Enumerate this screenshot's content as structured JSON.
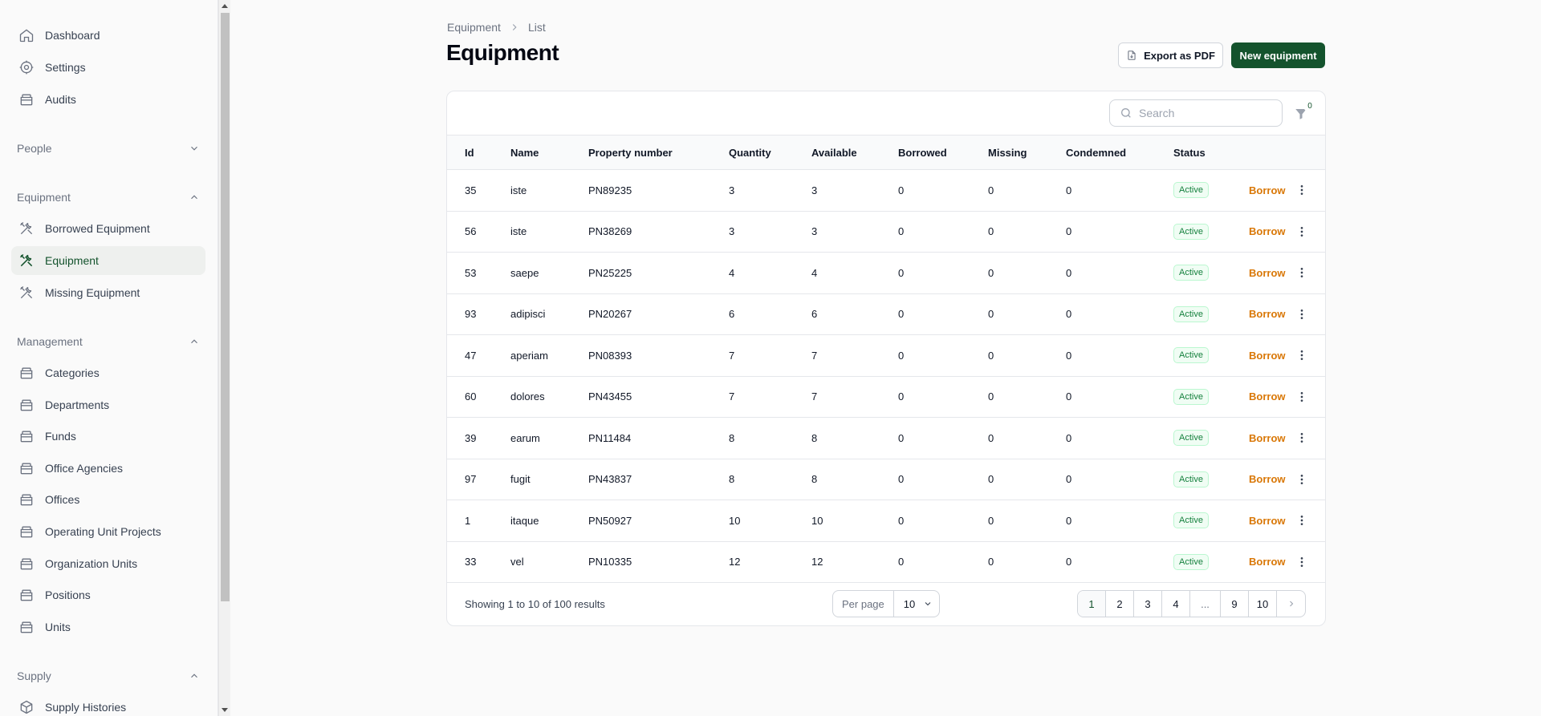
{
  "sidebar": {
    "top_items": [
      {
        "label": "Dashboard",
        "icon": "home-icon"
      },
      {
        "label": "Settings",
        "icon": "gear-icon"
      },
      {
        "label": "Audits",
        "icon": "box-icon"
      }
    ],
    "groups": {
      "people": {
        "label": "People",
        "expanded": false
      },
      "equipment": {
        "label": "Equipment",
        "expanded": true,
        "items": [
          {
            "label": "Borrowed Equipment",
            "icon": "tools-icon"
          },
          {
            "label": "Equipment",
            "icon": "tools-icon",
            "active": true
          },
          {
            "label": "Missing Equipment",
            "icon": "tools-icon"
          }
        ]
      },
      "management": {
        "label": "Management",
        "expanded": true,
        "items": [
          {
            "label": "Categories",
            "icon": "box-icon"
          },
          {
            "label": "Departments",
            "icon": "box-icon"
          },
          {
            "label": "Funds",
            "icon": "box-icon"
          },
          {
            "label": "Office Agencies",
            "icon": "box-icon"
          },
          {
            "label": "Offices",
            "icon": "box-icon"
          },
          {
            "label": "Operating Unit Projects",
            "icon": "box-icon"
          },
          {
            "label": "Organization Units",
            "icon": "box-icon"
          },
          {
            "label": "Positions",
            "icon": "box-icon"
          },
          {
            "label": "Units",
            "icon": "box-icon"
          }
        ]
      },
      "supply": {
        "label": "Supply",
        "expanded": true,
        "items": [
          {
            "label": "Supply Histories",
            "icon": "cube-icon"
          }
        ]
      }
    }
  },
  "breadcrumb": {
    "items": [
      "Equipment",
      "List"
    ]
  },
  "page": {
    "title": "Equipment"
  },
  "actions": {
    "export_label": "Export as PDF",
    "new_label": "New equipment"
  },
  "search": {
    "placeholder": "Search",
    "value": ""
  },
  "filter": {
    "count": "0"
  },
  "table": {
    "columns": [
      "Id",
      "Name",
      "Property number",
      "Quantity",
      "Available",
      "Borrowed",
      "Missing",
      "Condemned",
      "Status"
    ],
    "rows": [
      {
        "id": "35",
        "name": "iste",
        "property_number": "PN89235",
        "quantity": "3",
        "available": "3",
        "borrowed": "0",
        "missing": "0",
        "condemned": "0",
        "status": "Active",
        "action": "Borrow"
      },
      {
        "id": "56",
        "name": "iste",
        "property_number": "PN38269",
        "quantity": "3",
        "available": "3",
        "borrowed": "0",
        "missing": "0",
        "condemned": "0",
        "status": "Active",
        "action": "Borrow"
      },
      {
        "id": "53",
        "name": "saepe",
        "property_number": "PN25225",
        "quantity": "4",
        "available": "4",
        "borrowed": "0",
        "missing": "0",
        "condemned": "0",
        "status": "Active",
        "action": "Borrow"
      },
      {
        "id": "93",
        "name": "adipisci",
        "property_number": "PN20267",
        "quantity": "6",
        "available": "6",
        "borrowed": "0",
        "missing": "0",
        "condemned": "0",
        "status": "Active",
        "action": "Borrow"
      },
      {
        "id": "47",
        "name": "aperiam",
        "property_number": "PN08393",
        "quantity": "7",
        "available": "7",
        "borrowed": "0",
        "missing": "0",
        "condemned": "0",
        "status": "Active",
        "action": "Borrow"
      },
      {
        "id": "60",
        "name": "dolores",
        "property_number": "PN43455",
        "quantity": "7",
        "available": "7",
        "borrowed": "0",
        "missing": "0",
        "condemned": "0",
        "status": "Active",
        "action": "Borrow"
      },
      {
        "id": "39",
        "name": "earum",
        "property_number": "PN11484",
        "quantity": "8",
        "available": "8",
        "borrowed": "0",
        "missing": "0",
        "condemned": "0",
        "status": "Active",
        "action": "Borrow"
      },
      {
        "id": "97",
        "name": "fugit",
        "property_number": "PN43837",
        "quantity": "8",
        "available": "8",
        "borrowed": "0",
        "missing": "0",
        "condemned": "0",
        "status": "Active",
        "action": "Borrow"
      },
      {
        "id": "1",
        "name": "itaque",
        "property_number": "PN50927",
        "quantity": "10",
        "available": "10",
        "borrowed": "0",
        "missing": "0",
        "condemned": "0",
        "status": "Active",
        "action": "Borrow"
      },
      {
        "id": "33",
        "name": "vel",
        "property_number": "PN10335",
        "quantity": "12",
        "available": "12",
        "borrowed": "0",
        "missing": "0",
        "condemned": "0",
        "status": "Active",
        "action": "Borrow"
      }
    ]
  },
  "pagination": {
    "summary": "Showing 1 to 10 of 100 results",
    "per_page_label": "Per page",
    "per_page_value": "10",
    "pages": [
      "1",
      "2",
      "3",
      "4",
      "...",
      "9",
      "10"
    ],
    "current": "1"
  },
  "colors": {
    "brand": "#14532d",
    "borrow_action": "#d97706",
    "status_active": "#15803d"
  }
}
